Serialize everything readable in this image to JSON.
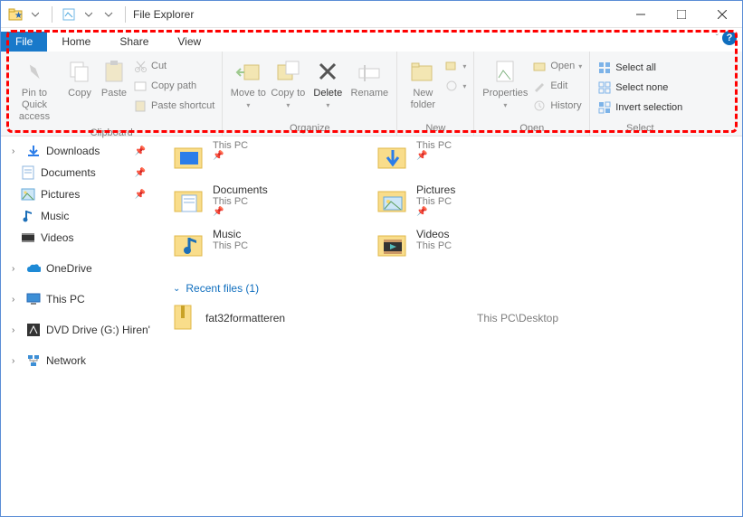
{
  "window": {
    "title": "File Explorer"
  },
  "tabs": {
    "file": "File",
    "home": "Home",
    "share": "Share",
    "view": "View"
  },
  "ribbon": {
    "clipboard": {
      "pin": "Pin to Quick access",
      "copy": "Copy",
      "paste": "Paste",
      "cut": "Cut",
      "copypath": "Copy path",
      "pasteshortcut": "Paste shortcut",
      "label": "Clipboard"
    },
    "organize": {
      "moveto": "Move to",
      "copyto": "Copy to",
      "deletelbl": "Delete",
      "rename": "Rename",
      "label": "Organize"
    },
    "new": {
      "newfolder": "New folder",
      "label": "New"
    },
    "open": {
      "properties": "Properties",
      "open": "Open",
      "edit": "Edit",
      "history": "History",
      "label": "Open"
    },
    "select": {
      "selectall": "Select all",
      "selectnone": "Select none",
      "invert": "Invert selection",
      "label": "Select"
    }
  },
  "sidebar": {
    "downloads": "Downloads",
    "documents": "Documents",
    "pictures": "Pictures",
    "music": "Music",
    "videos": "Videos",
    "onedrive": "OneDrive",
    "thispc": "This PC",
    "dvd": "DVD Drive (G:) Hiren'",
    "network": "Network"
  },
  "folders": {
    "loc": "This PC",
    "documents": "Documents",
    "pictures": "Pictures",
    "music": "Music",
    "videos": "Videos"
  },
  "recent": {
    "header": "Recent files (1)",
    "item1": {
      "name": "fat32formatteren",
      "loc": "This PC\\Desktop"
    }
  }
}
